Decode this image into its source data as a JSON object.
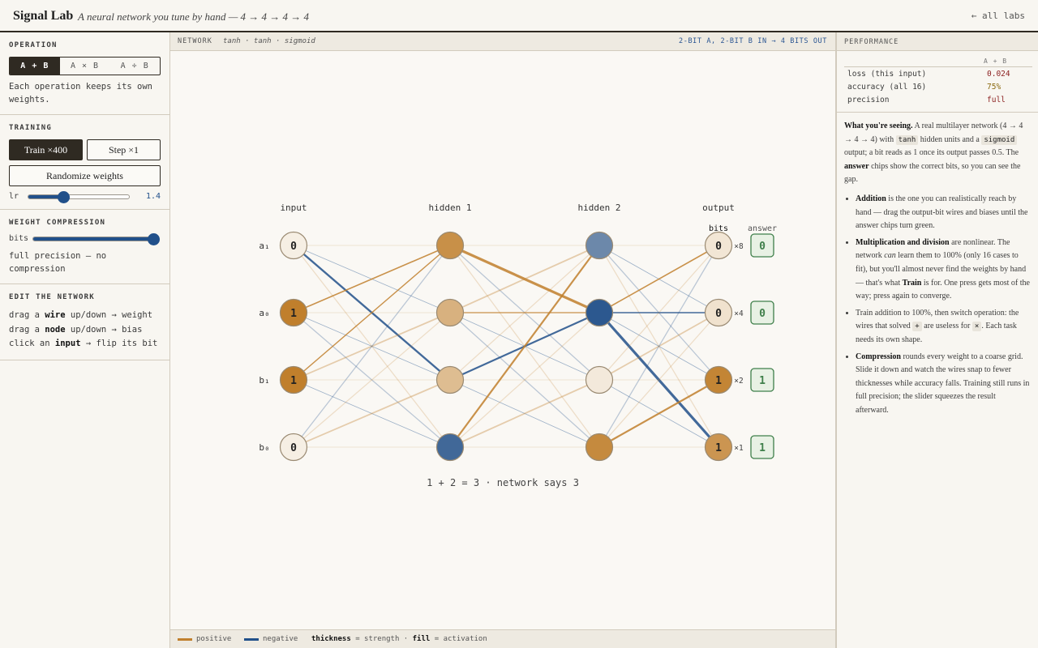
{
  "header": {
    "title": "Signal Lab",
    "subtitle": "A neural network you tune by hand — 4 → 4 → 4 → 4",
    "back_link": "← all labs"
  },
  "sidebar": {
    "operation": {
      "heading": "OPERATION",
      "options": [
        "A + B",
        "A × B",
        "A ÷ B"
      ],
      "selected": "A + B",
      "note": "Each operation keeps its own weights."
    },
    "training": {
      "heading": "TRAINING",
      "train_label": "Train ×400",
      "step_label": "Step ×1",
      "randomize_label": "Randomize weights",
      "lr_label": "lr",
      "lr_value": "1.4",
      "lr_fraction": 0.35
    },
    "compression": {
      "heading": "WEIGHT COMPRESSION",
      "bits_label": "bits",
      "bits_fraction": 1.0,
      "status": "full precision — no compression"
    },
    "edit": {
      "heading": "EDIT THE NETWORK",
      "lines": [
        {
          "pre": "drag a ",
          "key": "wire",
          "post": " up/down → weight"
        },
        {
          "pre": "drag a ",
          "key": "node",
          "post": " up/down → bias"
        },
        {
          "pre": "click an ",
          "key": "input",
          "post": " → flip its bit"
        }
      ]
    }
  },
  "network": {
    "label": "NETWORK",
    "activations": "tanh · tanh · sigmoid",
    "io_note": "2-BIT A, 2-BIT B IN → 4 BITS OUT",
    "layer_titles": [
      "input",
      "hidden 1",
      "hidden 2",
      "output"
    ],
    "bits_header": "bits",
    "answer_header": "answer",
    "input_names": [
      "a₁",
      "a₀",
      "b₁",
      "b₀"
    ],
    "input_bits": [
      "0",
      "1",
      "1",
      "0"
    ],
    "output_bits": [
      "0",
      "0",
      "1",
      "1"
    ],
    "output_weights": [
      "×8",
      "×4",
      "×2",
      "×1"
    ],
    "answers": [
      "0",
      "0",
      "1",
      "1"
    ],
    "activations_levels": {
      "input": [
        0,
        1,
        1,
        0
      ],
      "hidden1": [
        0.85,
        0.55,
        0.45,
        -0.85
      ],
      "hidden2": [
        -0.65,
        -0.95,
        0.05,
        0.9
      ],
      "output": [
        0.08,
        0.12,
        0.95,
        0.8
      ]
    },
    "summary": "1 + 2 = 3 · network says 3",
    "colors": {
      "positive": "#c07f2c",
      "negative": "#21508a"
    }
  },
  "legend": {
    "positive": "positive",
    "negative": "negative",
    "thickness_key": "thickness",
    "thickness_text": " = strength · ",
    "fill_key": "fill",
    "fill_text": " = activation"
  },
  "performance": {
    "heading": "PERFORMANCE",
    "column": "A + B",
    "rows": [
      {
        "label": "loss (this input)",
        "value": "0.024",
        "color": "#8b1f1f"
      },
      {
        "label": "accuracy (all 16)",
        "value": "75%",
        "color": "#8a6a10"
      },
      {
        "label": "precision",
        "value": "full",
        "color": "#8b1f1f"
      }
    ]
  }
}
